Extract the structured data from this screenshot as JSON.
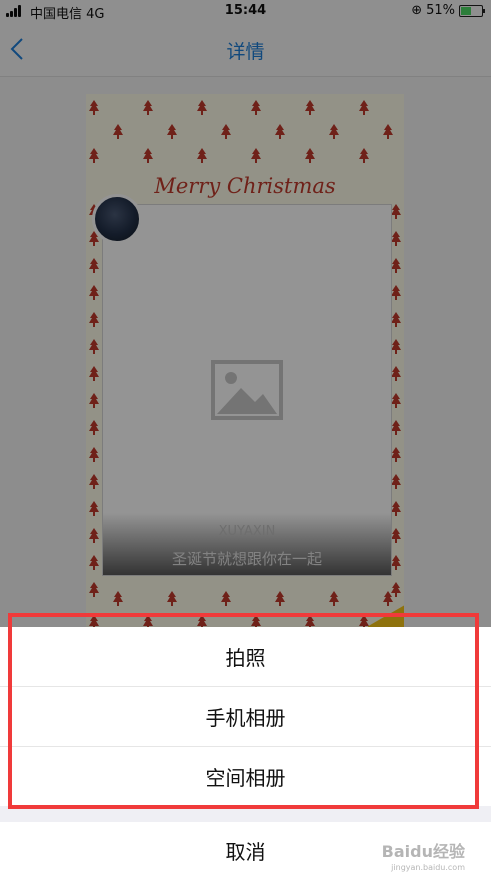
{
  "status_bar": {
    "carrier": "中国电信",
    "network": "4G",
    "time": "15:44",
    "battery_percent": "51%",
    "battery_level": 0.51
  },
  "nav": {
    "title": "详情"
  },
  "card": {
    "heading": "Merry Christmas",
    "author": "XUYAXIN",
    "caption": "圣诞节就想跟你在一起"
  },
  "action_sheet": {
    "items": [
      {
        "label": "拍照"
      },
      {
        "label": "手机相册"
      },
      {
        "label": "空间相册"
      }
    ],
    "cancel_label": "取消"
  },
  "watermark": {
    "text": "Baidu经验",
    "sub": "jingyan.baidu.com"
  },
  "colors": {
    "accent": "#1e7fd7",
    "highlight": "#f03a3a",
    "tree": "#c0392b"
  }
}
